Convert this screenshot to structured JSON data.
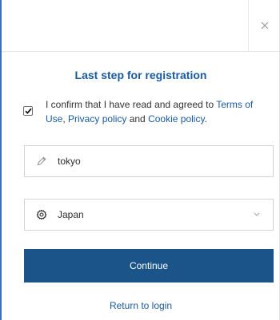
{
  "dialog": {
    "close_icon": "close-icon",
    "title": "Last step for registration",
    "consent": {
      "checked": true,
      "text_before": "I confirm that I have read and agreed to ",
      "terms_link": "Terms of Use",
      "comma": ", ",
      "privacy_link": "Privacy policy",
      "and": " and ",
      "cookie_link": "Cookie policy",
      "period": "."
    },
    "city_field": {
      "icon": "pencil-icon",
      "value": "tokyo"
    },
    "country_field": {
      "icon": "gear-icon",
      "value": "Japan",
      "chevron": "chevron-down-icon"
    },
    "continue_label": "Continue",
    "return_label": "Return to login"
  },
  "colors": {
    "accent": "#1a5aa0",
    "button": "#1b5489",
    "border": "#d4d4d4"
  }
}
